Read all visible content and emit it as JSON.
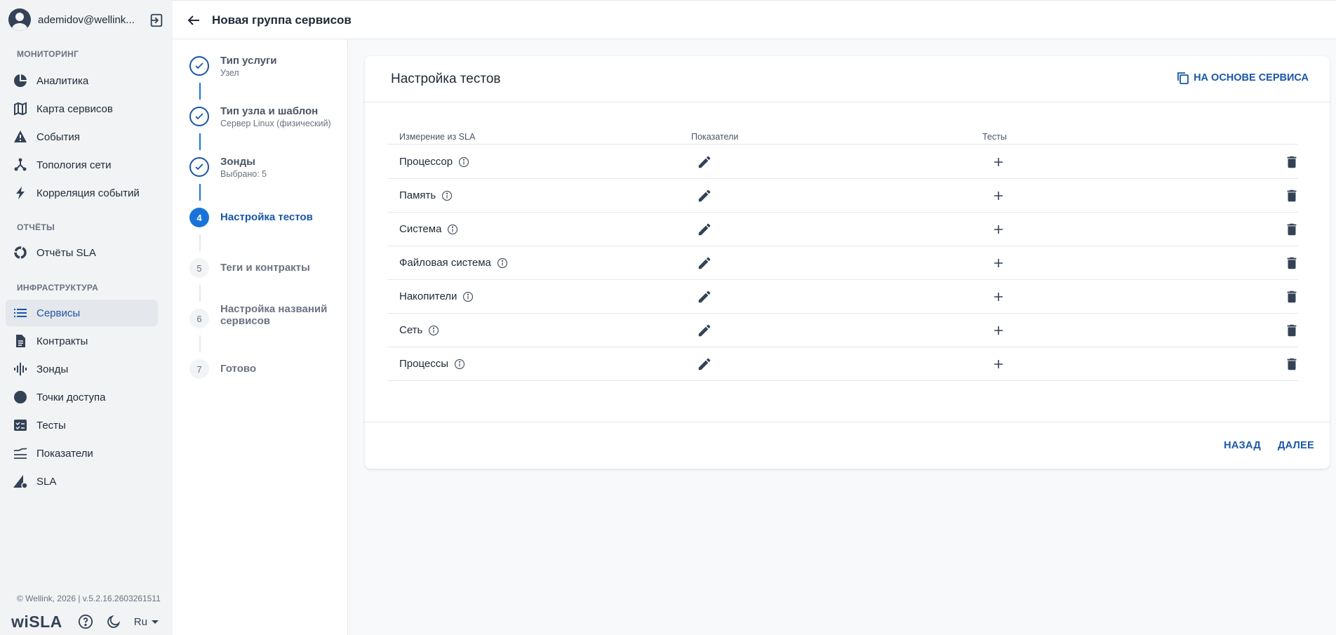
{
  "user": {
    "name": "ademidov@wellink..."
  },
  "sidebar": {
    "sections": [
      {
        "title": "МОНИТОРИНГ"
      },
      {
        "title": "ОТЧЁТЫ"
      },
      {
        "title": "ИНФРАСТРУКТУРА"
      }
    ],
    "items": [
      {
        "label": "Аналитика",
        "icon": "analytics-icon"
      },
      {
        "label": "Карта сервисов",
        "icon": "map-icon"
      },
      {
        "label": "События",
        "icon": "warning-icon"
      },
      {
        "label": "Топология сети",
        "icon": "topology-icon"
      },
      {
        "label": "Корреляция событий",
        "icon": "bolt-icon"
      },
      {
        "label": "Отчёты SLA",
        "icon": "donut-icon"
      },
      {
        "label": "Сервисы",
        "icon": "list-icon",
        "active": true
      },
      {
        "label": "Контракты",
        "icon": "document-icon"
      },
      {
        "label": "Зонды",
        "icon": "waveform-icon"
      },
      {
        "label": "Точки доступа",
        "icon": "dot-icon"
      },
      {
        "label": "Тесты",
        "icon": "checklist-icon"
      },
      {
        "label": "Показатели",
        "icon": "metrics-icon"
      },
      {
        "label": "SLA",
        "icon": "sla-icon"
      }
    ],
    "copyright": "© Wellink, 2026 | v.5.2.16.2603261511",
    "brand": "wiSLA",
    "lang": "Ru"
  },
  "header": {
    "title": "Новая группа сервисов"
  },
  "stepper": {
    "steps": [
      {
        "num": "1",
        "title": "Тип услуги",
        "sub": "Узел",
        "state": "done"
      },
      {
        "num": "2",
        "title": "Тип узла и шаблон",
        "sub": "Сервер Linux (физический)",
        "state": "done"
      },
      {
        "num": "3",
        "title": "Зонды",
        "sub": "Выбрано: 5",
        "state": "done"
      },
      {
        "num": "4",
        "title": "Настройка тестов",
        "sub": "",
        "state": "current"
      },
      {
        "num": "5",
        "title": "Теги и контракты",
        "sub": "",
        "state": "pending"
      },
      {
        "num": "6",
        "title": "Настройка названий сервисов",
        "sub": "",
        "state": "pending"
      },
      {
        "num": "7",
        "title": "Готово",
        "sub": "",
        "state": "pending"
      }
    ]
  },
  "card": {
    "title": "Настройка тестов",
    "copy_button": "НА ОСНОВЕ СЕРВИСА",
    "columns": [
      "Измерение из SLA",
      "Показатели",
      "Тесты"
    ],
    "rows": [
      {
        "name": "Процессор"
      },
      {
        "name": "Память"
      },
      {
        "name": "Система"
      },
      {
        "name": "Файловая система"
      },
      {
        "name": "Накопители"
      },
      {
        "name": "Сеть"
      },
      {
        "name": "Процессы"
      }
    ],
    "back_button": "НАЗАД",
    "next_button": "ДАЛЕЕ"
  },
  "colors": {
    "accent": "#1a56a8",
    "step_active": "#1a73d9",
    "icon": "#344256"
  }
}
